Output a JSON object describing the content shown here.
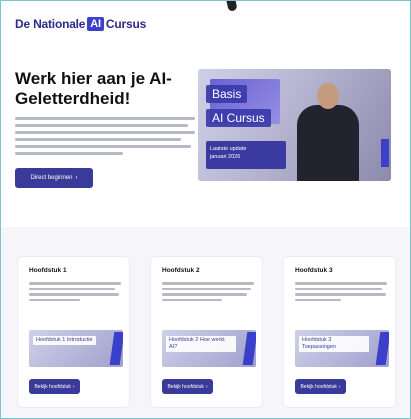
{
  "navbar": {
    "logo_prefix": "De Nationale",
    "logo_ai": "AI",
    "logo_suffix": "Cursus"
  },
  "hero": {
    "title": "Werk hier aan je AI-Geletterdheid!",
    "button_label": "Direct beginnen",
    "button_icon": "chevron-right-icon",
    "media": {
      "label_line1": "Basis",
      "label_line2": "AI Cursus",
      "update_line1": "Laatste update",
      "update_line2": "januari 2026"
    }
  },
  "cards": [
    {
      "title": "Hoofdstuk 1",
      "thumb_label": "Hoofdstuk 1 Introductie",
      "button_label": "Bekijk hoofdstuk"
    },
    {
      "title": "Hoofdstuk 2",
      "thumb_label": "Hoofdstuk 2 Hoe werkt AI?",
      "button_label": "Bekijk hoofdstuk"
    },
    {
      "title": "Hoofdstuk 3",
      "thumb_label": "Hoofdstuk 3 Toepassingen",
      "button_label": "Bekijk hoofdstuk"
    }
  ],
  "colors": {
    "brand": "#3b3fc9",
    "button": "#3a3a9a",
    "section_bg": "#f5f5fa"
  }
}
